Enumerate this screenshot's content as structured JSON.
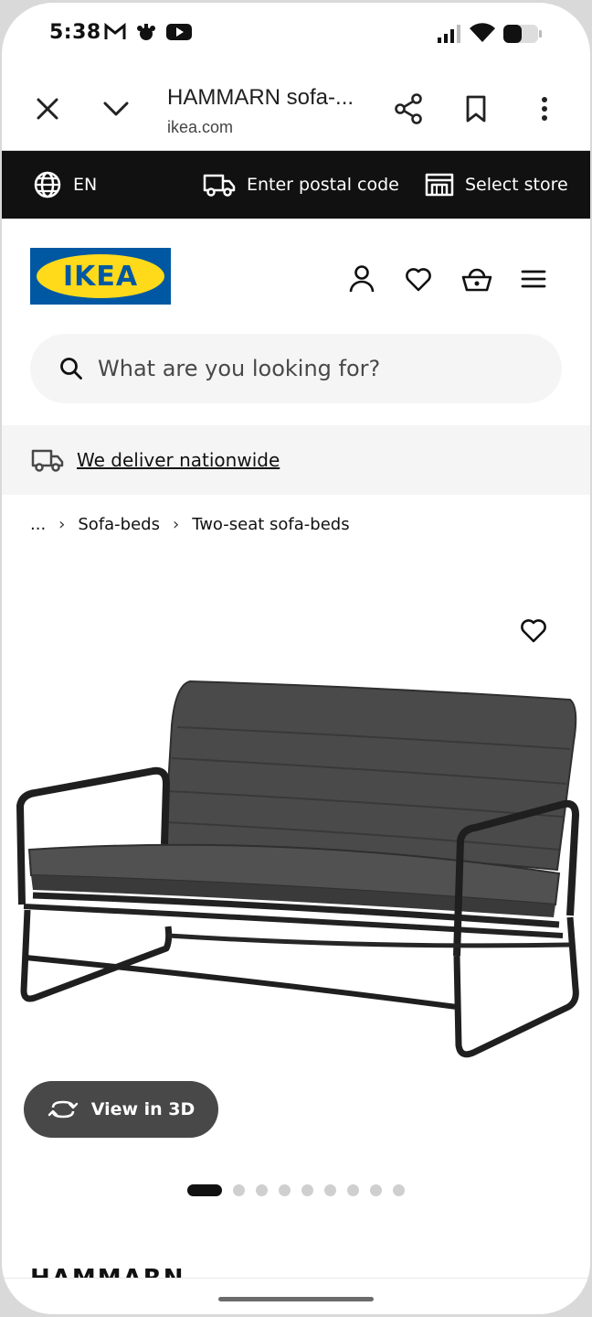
{
  "status_bar": {
    "time": "5:38"
  },
  "browser": {
    "page_title": "HAMMARN sofa-...",
    "url": "ikea.com"
  },
  "top_bar": {
    "language": "EN",
    "postal": "Enter postal code",
    "store": "Select store"
  },
  "header": {
    "logo_text": "IKEA",
    "brand_blue": "#0058a3",
    "brand_yellow": "#ffda1a"
  },
  "search": {
    "placeholder": "What are you looking for?"
  },
  "banner": {
    "text": "We deliver nationwide"
  },
  "breadcrumb": {
    "ellipsis": "...",
    "items": [
      "Sofa-beds",
      "Two-seat sofa-beds"
    ]
  },
  "product": {
    "view3d_label": "View in 3D",
    "image_count": 9,
    "active_image": 1,
    "name": "HAMMARN"
  }
}
